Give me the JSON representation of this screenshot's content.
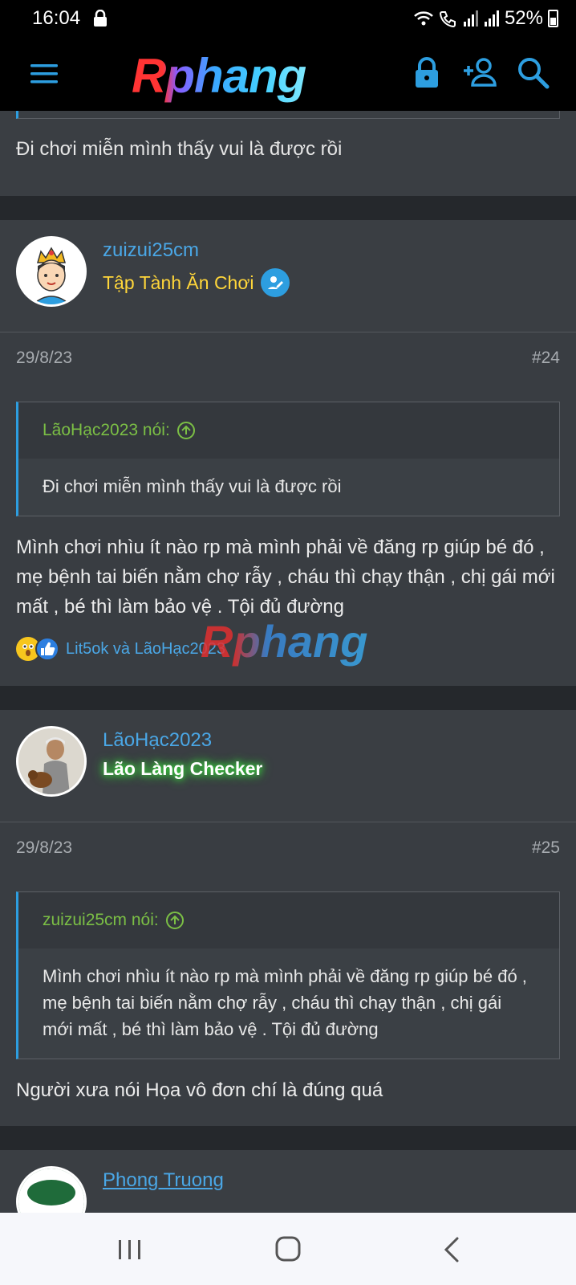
{
  "status": {
    "time": "16:04",
    "battery": "52%"
  },
  "header": {
    "logo": "Rphang"
  },
  "previous_post": {
    "message": "Đi chơi miễn mình thấy vui là được rồi"
  },
  "posts": [
    {
      "user": {
        "name": "zuizui25cm",
        "title": "Tập Tành Ăn Chơi"
      },
      "date": "29/8/23",
      "number": "#24",
      "quote": {
        "author": "LãoHạc2023 nói:",
        "text": "Đi chơi miễn mình thấy vui là được rồi"
      },
      "message": "Mình chơi nhìu ít nào rp mà mình phải về đăng rp giúp bé đó , mẹ bệnh tai biến nằm chợ rẫy , cháu thì chạy thận , chị gái mới mất , bé thì làm bảo vệ . Tội đủ đường",
      "reactions": {
        "users": "Lit5ok và LãoHạc2023"
      },
      "watermark": "Rphang"
    },
    {
      "user": {
        "name": "LãoHạc2023",
        "title": "Lão Làng Checker"
      },
      "date": "29/8/23",
      "number": "#25",
      "quote": {
        "author": "zuizui25cm nói:",
        "text": "Mình chơi nhìu ít nào rp mà mình phải về đăng rp giúp bé đó , mẹ bệnh tai biến nằm chợ rẫy , cháu thì chạy thận , chị gái mới mất , bé thì làm bảo vệ . Tội đủ đường"
      },
      "message": "Người xưa nói Họa vô đơn chí là đúng quá"
    }
  ],
  "next_post": {
    "user": {
      "name": "Phong Truong"
    }
  },
  "colors": {
    "accent": "#2d9ee0",
    "username": "#4aa7e6",
    "title_yellow": "#ffd63a",
    "quote_author": "#7bbf45"
  }
}
